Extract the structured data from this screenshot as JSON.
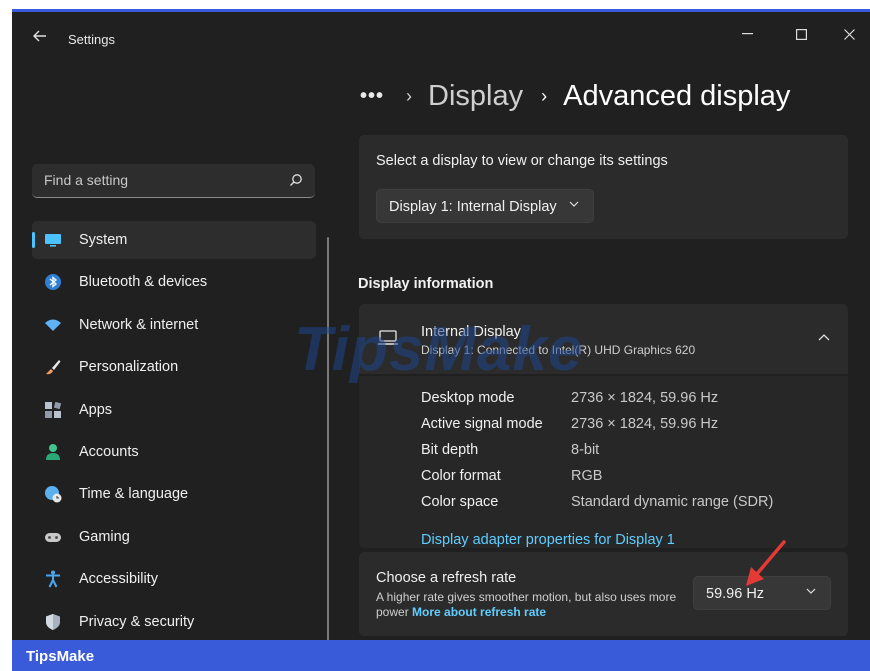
{
  "window": {
    "title": "Settings",
    "controls": [
      "minimize",
      "maximize",
      "close"
    ]
  },
  "sidebar": {
    "search_placeholder": "Find a setting",
    "items": [
      {
        "label": "System",
        "icon": "monitor-icon",
        "color": "#4cc2ff",
        "active": true
      },
      {
        "label": "Bluetooth & devices",
        "icon": "bluetooth-icon",
        "color": "#3a8ee6"
      },
      {
        "label": "Network & internet",
        "icon": "wifi-icon",
        "color": "#5fb2f5"
      },
      {
        "label": "Personalization",
        "icon": "brush-icon",
        "color": "#f29b5c"
      },
      {
        "label": "Apps",
        "icon": "apps-icon",
        "color": "#b8c2d0"
      },
      {
        "label": "Accounts",
        "icon": "person-icon",
        "color": "#3fc58f"
      },
      {
        "label": "Time & language",
        "icon": "globe-clock-icon",
        "color": "#5ab0f0"
      },
      {
        "label": "Gaming",
        "icon": "gamepad-icon",
        "color": "#c8c8c8"
      },
      {
        "label": "Accessibility",
        "icon": "accessibility-icon",
        "color": "#4aa8f0"
      },
      {
        "label": "Privacy & security",
        "icon": "shield-icon",
        "color": "#a9b3bf"
      }
    ]
  },
  "header": {
    "more": "•••",
    "parent": "Display",
    "current": "Advanced display"
  },
  "select_display": {
    "prompt": "Select a display to view or change its settings",
    "selected": "Display 1: Internal Display"
  },
  "display_info": {
    "section_title": "Display information",
    "name": "Internal Display",
    "subtitle": "Display 1: Connected to Intel(R) UHD Graphics 620",
    "rows": [
      {
        "key": "Desktop mode",
        "value": "2736 × 1824, 59.96 Hz"
      },
      {
        "key": "Active signal mode",
        "value": "2736 × 1824, 59.96 Hz"
      },
      {
        "key": "Bit depth",
        "value": "8-bit"
      },
      {
        "key": "Color format",
        "value": "RGB"
      },
      {
        "key": "Color space",
        "value": "Standard dynamic range (SDR)"
      }
    ],
    "adapter_link": "Display adapter properties for Display 1"
  },
  "refresh_rate": {
    "title": "Choose a refresh rate",
    "description": "A higher rate gives smoother motion, but also uses more power",
    "link": "More about refresh rate",
    "selected": "59.96 Hz"
  },
  "watermark": "TipsMake",
  "brand": "TipsMake",
  "colors": {
    "accent": "#4cc2ff",
    "link": "#60cdff",
    "annotation_arrow": "#e53935",
    "brand_bar": "#3a5bd9"
  }
}
